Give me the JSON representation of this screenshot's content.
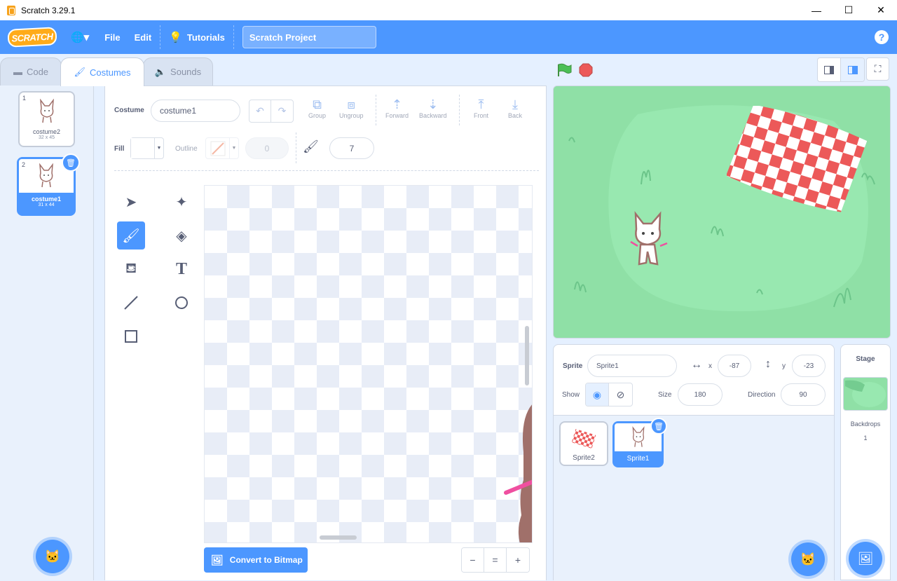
{
  "window": {
    "title": "Scratch 3.29.1",
    "minimize": "—",
    "maximize": "☐",
    "close": "✕"
  },
  "menubar": {
    "logo": "SCRATCH",
    "language_icon": "🌐▾",
    "file": "File",
    "edit": "Edit",
    "tutorials": "Tutorials",
    "project_title": "Scratch Project",
    "help": "?"
  },
  "tabs": [
    {
      "label": "Code"
    },
    {
      "label": "Costumes"
    },
    {
      "label": "Sounds"
    }
  ],
  "costumes": [
    {
      "num": "1",
      "name": "costume2",
      "size": "32 x 45"
    },
    {
      "num": "2",
      "name": "costume1",
      "size": "31 x 44"
    }
  ],
  "editor": {
    "costume_label": "Costume",
    "costume_name": "costume1",
    "group": "Group",
    "ungroup": "Ungroup",
    "forward": "Forward",
    "backward": "Backward",
    "front": "Front",
    "back": "Back",
    "fill_label": "Fill",
    "outline_label": "Outline",
    "outline_width": "0",
    "brush_size": "7",
    "convert": "Convert to Bitmap",
    "zoom_out": "−",
    "zoom_reset": "=",
    "zoom_in": "+"
  },
  "sprite_info": {
    "sprite_label": "Sprite",
    "sprite_name": "Sprite1",
    "x_label": "x",
    "x": "-87",
    "y_label": "y",
    "y": "-23",
    "show_label": "Show",
    "size_label": "Size",
    "size": "180",
    "direction_label": "Direction",
    "direction": "90"
  },
  "sprites": [
    {
      "name": "Sprite2"
    },
    {
      "name": "Sprite1"
    }
  ],
  "stage_panel": {
    "title": "Stage",
    "backdrops_label": "Backdrops",
    "backdrops_count": "1"
  },
  "colors": {
    "accent": "#4c97ff",
    "menubar": "#4c97ff",
    "stage_bg": "#8fe0a6",
    "flag": "#4cbf56",
    "stop": "#ec5959"
  }
}
